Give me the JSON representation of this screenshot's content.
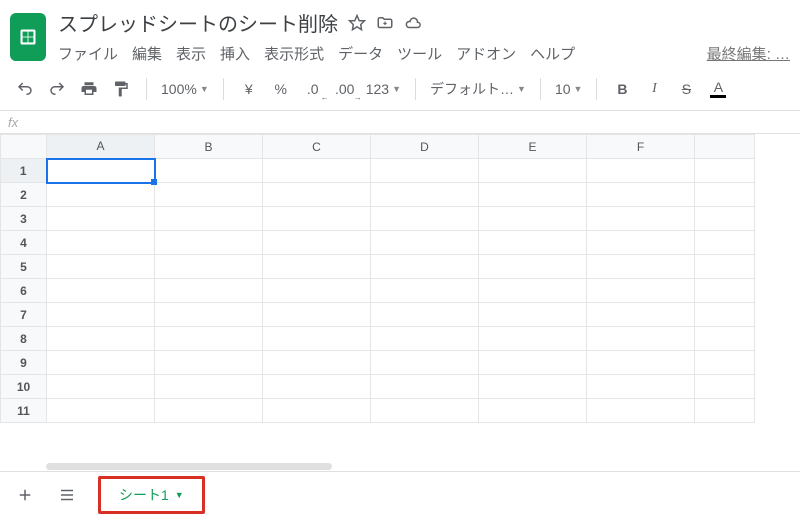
{
  "document": {
    "title": "スプレッドシートのシート削除"
  },
  "menubar": {
    "items": [
      "ファイル",
      "編集",
      "表示",
      "挿入",
      "表示形式",
      "データ",
      "ツール",
      "アドオン",
      "ヘルプ"
    ],
    "last_edit": "最終編集: …"
  },
  "toolbar": {
    "zoom": "100%",
    "currency": "¥",
    "percent": "%",
    "dec_dec": ".0",
    "dec_inc": ".00",
    "number_format": "123",
    "font": "デフォルト…",
    "font_size": "10",
    "bold": "B",
    "italic": "I",
    "strike": "S",
    "text_color": "A"
  },
  "formula_bar": {
    "fx": "fx"
  },
  "grid": {
    "columns": [
      "A",
      "B",
      "C",
      "D",
      "E",
      "F"
    ],
    "rows": [
      "1",
      "2",
      "3",
      "4",
      "5",
      "6",
      "7",
      "8",
      "9",
      "10",
      "11"
    ],
    "selected": {
      "col": "A",
      "row": "1"
    }
  },
  "sheets": {
    "active": "シート1"
  }
}
